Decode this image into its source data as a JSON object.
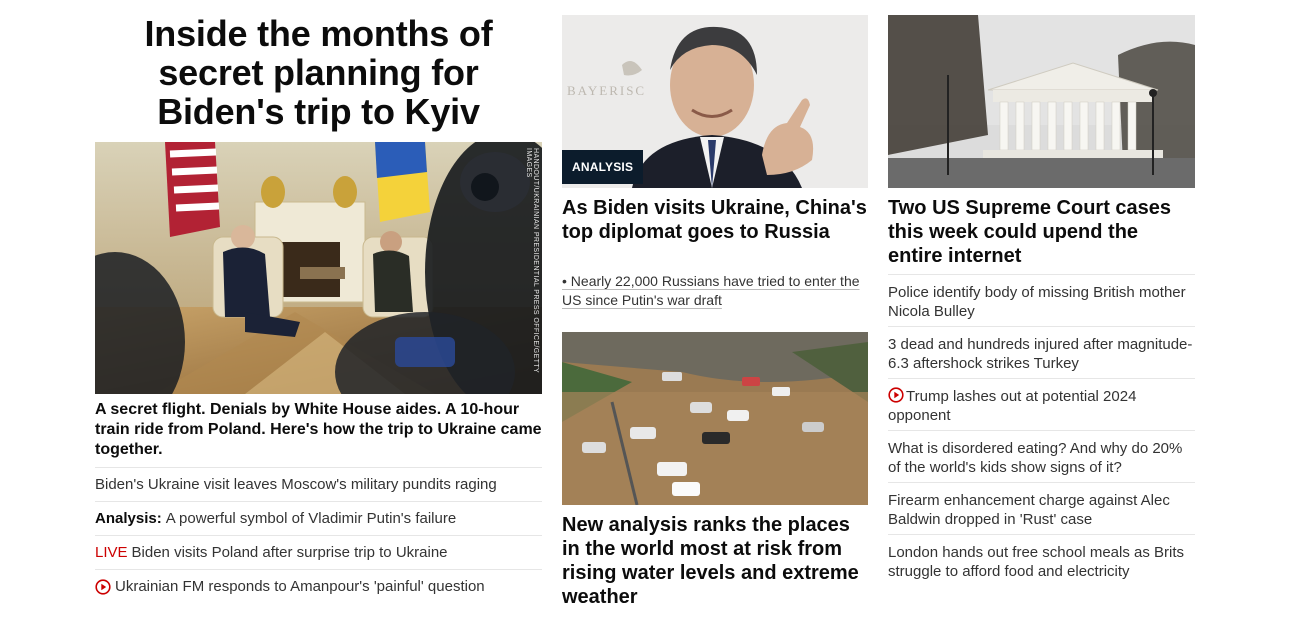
{
  "lead": {
    "title": "Inside the months of secret planning for Biden's trip to Kyiv",
    "image_credit": "HANDOUT/UKRAINIAN PRESIDENTIAL PRESS OFFICE/GETTY IMAGES",
    "summary": "A secret flight. Denials by White House aides. A 10-hour train ride from Poland. Here's how the trip to Ukraine came together.",
    "links": [
      {
        "prefix": "",
        "text": "Biden's Ukraine visit leaves Moscow's military pundits raging"
      },
      {
        "prefix": "Analysis:",
        "text": "A powerful symbol of Vladimir Putin's failure"
      },
      {
        "prefix": "LIVE",
        "text": "Biden visits Poland after surprise trip to Ukraine"
      },
      {
        "prefix": "",
        "text": "Ukrainian FM responds to Amanpour's 'painful' question",
        "icon": "play-icon"
      }
    ]
  },
  "middle": {
    "badge": "ANALYSIS",
    "headline": "As Biden visits Ukraine, China's top diplomat goes to Russia",
    "sublink": "• Nearly 22,000 Russians have tried to enter the US since Putin's war draft",
    "backdrop_text": "BAYERISC",
    "headline2": "New analysis ranks the places in the world most at risk from rising water levels and extreme weather"
  },
  "right": {
    "headline": "Two US Supreme Court cases this week could upend the entire internet",
    "links": [
      {
        "text": "Police identify body of missing British mother Nicola Bulley"
      },
      {
        "text": "3 dead and hundreds injured after magnitude-6.3 aftershock strikes Turkey"
      },
      {
        "text": "Trump lashes out at potential 2024 opponent",
        "icon": "play-icon"
      },
      {
        "text": "What is disordered eating? And why do 20% of the world's kids show signs of it?"
      },
      {
        "text": "Firearm enhancement charge against Alec Baldwin dropped in 'Rust' case"
      },
      {
        "text": "London hands out free school meals as Brits struggle to afford food and electricity"
      }
    ]
  },
  "colors": {
    "live": "#cc0000",
    "badge_bg": "#0c1c2c",
    "text": "#0c0c0c",
    "divider": "#e6e6e6"
  }
}
